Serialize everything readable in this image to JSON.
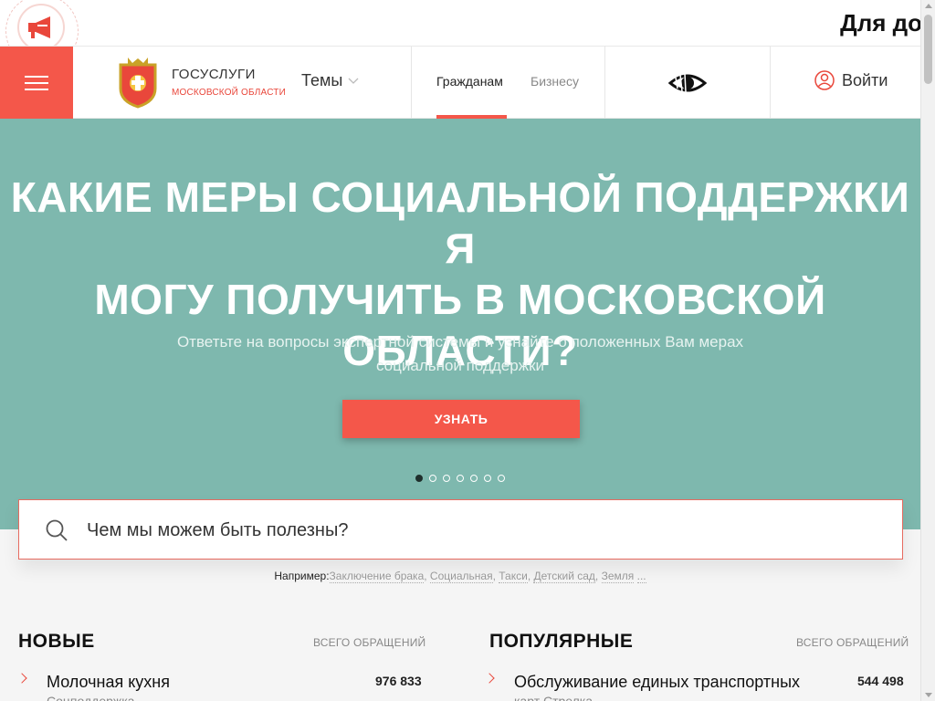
{
  "topbar": {
    "promo_text": "Для до",
    "promo_icon": "megaphone-icon"
  },
  "header": {
    "menu_icon": "hamburger-icon",
    "brand": {
      "title": "ГОСУСЛУГИ",
      "subtitle": "МОСКОВСКОЙ ОБЛАСТИ",
      "logo": "moscow-region-coat-of-arms"
    },
    "themes_label": "Темы",
    "tabs": [
      {
        "label": "Гражданам",
        "active": true
      },
      {
        "label": "Бизнесу",
        "active": false
      }
    ],
    "accessibility_icon": "eye-icon",
    "login_label": "Войти",
    "login_icon": "user-icon"
  },
  "hero": {
    "title": "КАКИЕ МЕРЫ СОЦИАЛЬНОЙ ПОДДЕРЖКИ Я\nМОГУ ПОЛУЧИТЬ В МОСКОВСКОЙ\nОБЛАСТИ?",
    "subtitle": "Ответьте на вопросы экспертной системы и узнайте о положенных Вам мерах\nсоциальной поддержки",
    "button_label": "УЗНАТЬ",
    "slides_total": 7,
    "active_slide": 1
  },
  "search": {
    "placeholder": "Чем мы можем быть полезны?",
    "icon": "search-icon"
  },
  "examples": {
    "lead": "Например:",
    "links": [
      "Заключение брака",
      "Социальная",
      "Такси",
      "Детский сад",
      "Земля"
    ],
    "more": "..."
  },
  "new_column": {
    "title": "НОВЫЕ",
    "caption": "ВСЕГО ОБРАЩЕНИЙ",
    "items": [
      {
        "title": "Молочная кухня",
        "subtitle": "Соцподдержка",
        "count": "976 833"
      }
    ]
  },
  "popular_column": {
    "title": "ПОПУЛЯРНЫЕ",
    "caption": "ВСЕГО ОБРАЩЕНИЙ",
    "items": [
      {
        "title": "Обслуживание единых транспортных",
        "subtitle": "карт Стрелка",
        "count": "544 498"
      }
    ]
  },
  "colors": {
    "accent": "#f4574a",
    "hero_bg": "#7eb8ae",
    "page_bg": "#f5f5f5"
  }
}
